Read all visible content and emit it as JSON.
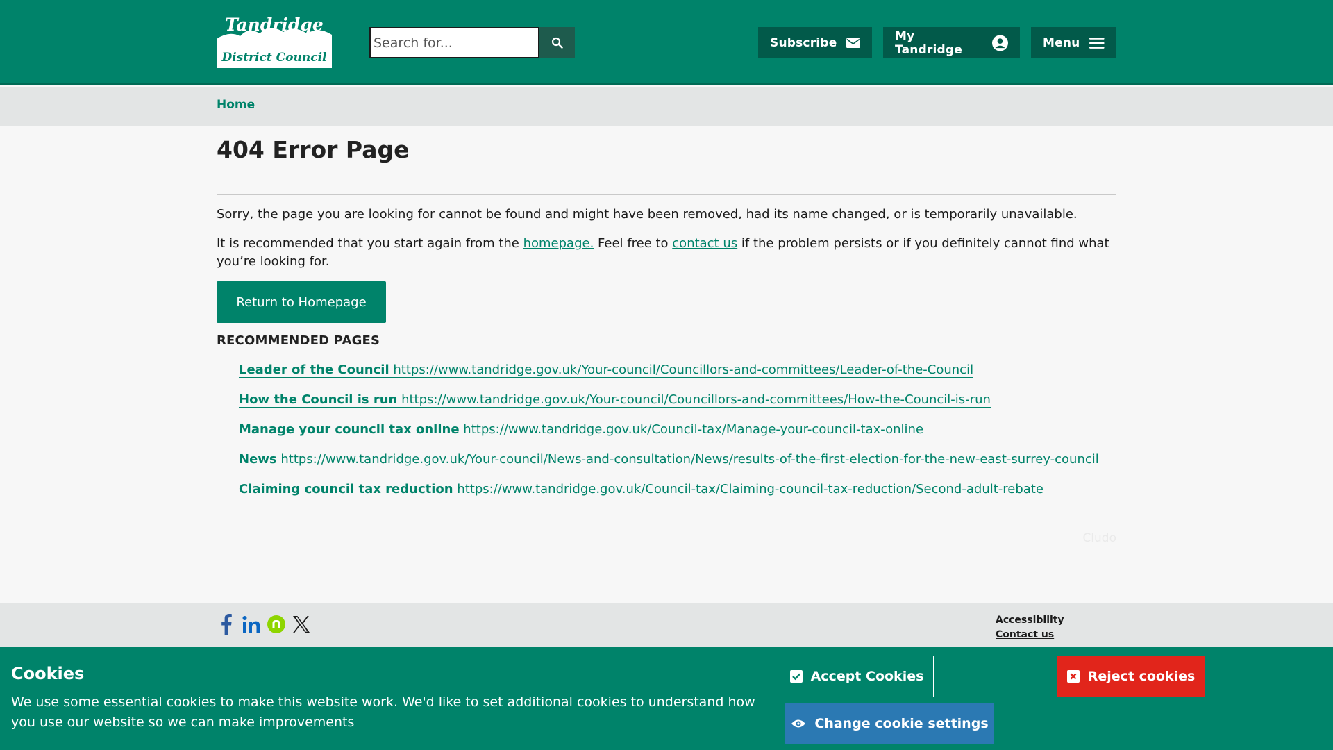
{
  "header": {
    "logo_line1": "Tandridge",
    "logo_line2": "District Council",
    "search_placeholder": "Search for...",
    "subscribe_label": "Subscribe",
    "my_tandridge_label": "My Tandridge",
    "menu_label": "Menu"
  },
  "breadcrumb": {
    "home": "Home"
  },
  "main": {
    "title": "404 Error Page",
    "para1": "Sorry, the page you are looking for cannot be found and might have been removed, had its name changed, or is temporarily unavailable.",
    "para2_a": "It is recommended that you start again from the ",
    "para2_link1": "homepage.",
    "para2_b": " Feel free to ",
    "para2_link2": "contact us",
    "para2_c": " if the problem persists or if you definitely cannot find what you’re looking for.",
    "cta": "Return to Homepage",
    "recommended_heading": "RECOMMENDED PAGES",
    "recommended": [
      {
        "title": "Leader of the Council",
        "url": "https://www.tandridge.gov.uk/Your-council/Councillors-and-committees/Leader-of-the-Council"
      },
      {
        "title": "How the Council is run",
        "url": "https://www.tandridge.gov.uk/Your-council/Councillors-and-committees/How-the-Council-is-run"
      },
      {
        "title": "Manage your council tax online",
        "url": "https://www.tandridge.gov.uk/Council-tax/Manage-your-council-tax-online"
      },
      {
        "title": "News",
        "url": "https://www.tandridge.gov.uk/Your-council/News-and-consultation/News/results-of-the-first-election-for-the-new-east-surrey-council"
      },
      {
        "title": "Claiming council tax reduction",
        "url": "https://www.tandridge.gov.uk/Council-tax/Claiming-council-tax-reduction/Second-adult-rebate"
      }
    ],
    "cludo": "Cludo"
  },
  "footer": {
    "social_icons": [
      "facebook-icon",
      "linkedin-icon",
      "nextdoor-icon",
      "x-icon"
    ],
    "links": [
      "Accessibility",
      "Contact us"
    ]
  },
  "cookies": {
    "title": "Cookies",
    "text": "We use some essential cookies to make this website work. We'd like to set additional cookies to understand how you use our website so we can make improvements",
    "accept": "Accept Cookies",
    "reject": "Reject cookies",
    "change": "Change cookie settings"
  },
  "colors": {
    "brand": "#00836a",
    "reject": "#e1251b",
    "change": "#2b79b3"
  }
}
